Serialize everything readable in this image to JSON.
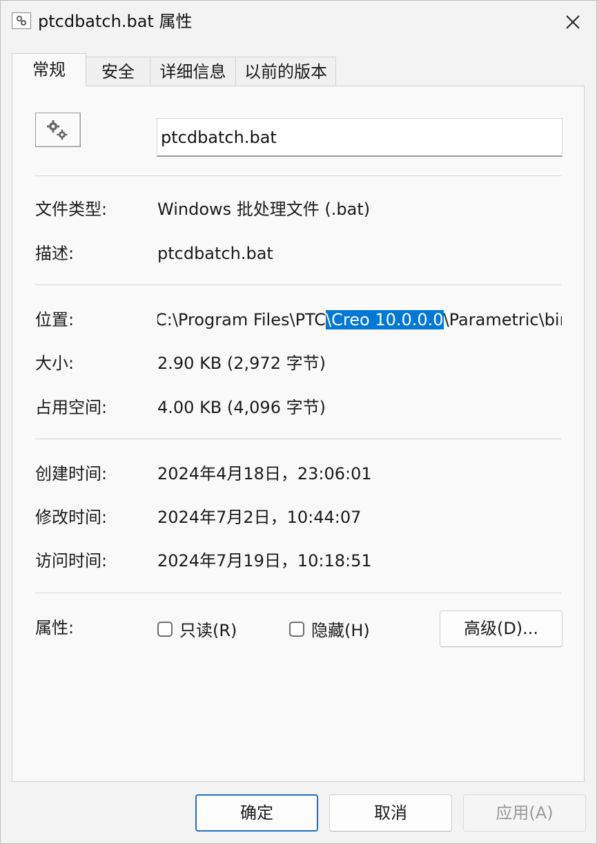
{
  "window": {
    "title": "ptcdbatch.bat 属性",
    "close_icon": "close-icon"
  },
  "tabs": [
    {
      "label": "常规",
      "active": true
    },
    {
      "label": "安全",
      "active": false
    },
    {
      "label": "详细信息",
      "active": false
    },
    {
      "label": "以前的版本",
      "active": false
    }
  ],
  "general": {
    "file_icon": "batch-file-gears-icon",
    "file_name": "ptcdbatch.bat",
    "file_type_label": "文件类型:",
    "file_type_value": "Windows 批处理文件 (.bat)",
    "description_label": "描述:",
    "description_value": "ptcdbatch.bat",
    "location_label": "位置:",
    "location_before": "C:\\Program Files\\PTC",
    "location_selected": "\\Creo 10.0.0.0",
    "location_after": "\\Parametric\\bin",
    "size_label": "大小:",
    "size_value": "2.90 KB (2,972 字节)",
    "size_on_disk_label": "占用空间:",
    "size_on_disk_value": "4.00 KB (4,096 字节)",
    "created_label": "创建时间:",
    "created_value": "2024年4月18日，23:06:01",
    "modified_label": "修改时间:",
    "modified_value": "2024年7月2日，10:44:07",
    "accessed_label": "访问时间:",
    "accessed_value": "2024年7月19日，10:18:51",
    "attributes_label": "属性:",
    "readonly_label": "只读(R)",
    "readonly_checked": false,
    "hidden_label": "隐藏(H)",
    "hidden_checked": false,
    "advanced_label": "高级(D)..."
  },
  "footer": {
    "ok_label": "确定",
    "cancel_label": "取消",
    "apply_label": "应用(A)",
    "apply_enabled": false
  },
  "colors": {
    "selection": "#0078d4",
    "primary_border": "#1f6fbf"
  }
}
